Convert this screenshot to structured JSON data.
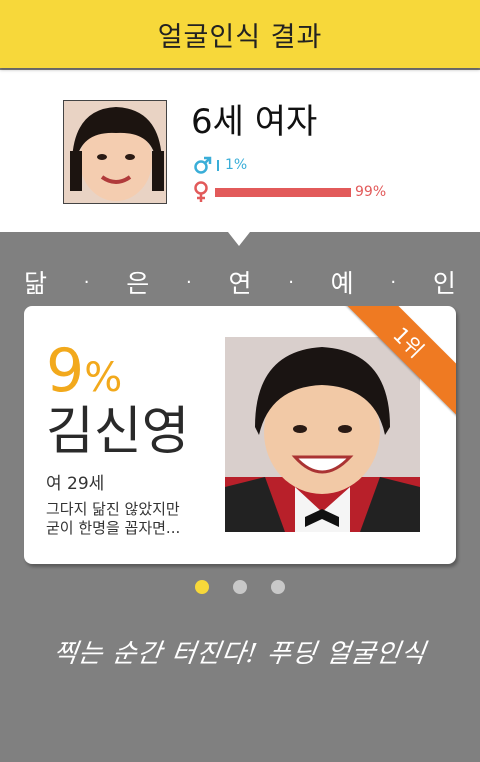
{
  "header": {
    "title": "얼굴인식 결과"
  },
  "profile": {
    "title": "6세 여자",
    "male": {
      "icon": "male-icon",
      "percent": "1%",
      "color": "#3aaed8"
    },
    "female": {
      "icon": "female-icon",
      "percent": "99%",
      "color": "#e25a5a"
    }
  },
  "section": {
    "chars": [
      "닮",
      "은",
      "연",
      "예",
      "인"
    ],
    "separator": "·"
  },
  "celebrity": {
    "rank": "1위",
    "similarity_number": "9",
    "similarity_sign": "%",
    "name": "김신영",
    "info": "여 29세",
    "desc_line1": "그다지 닮진 않았지만",
    "desc_line2": "굳이 한명을 꼽자면..."
  },
  "pager": {
    "count": 3,
    "active": 0
  },
  "slogan": "찍는 순간 터진다! 푸딩 얼굴인식",
  "colors": {
    "accent": "#f7d83a",
    "percent": "#f2a91c",
    "ribbon": "#ef7a22",
    "background": "#808080"
  }
}
